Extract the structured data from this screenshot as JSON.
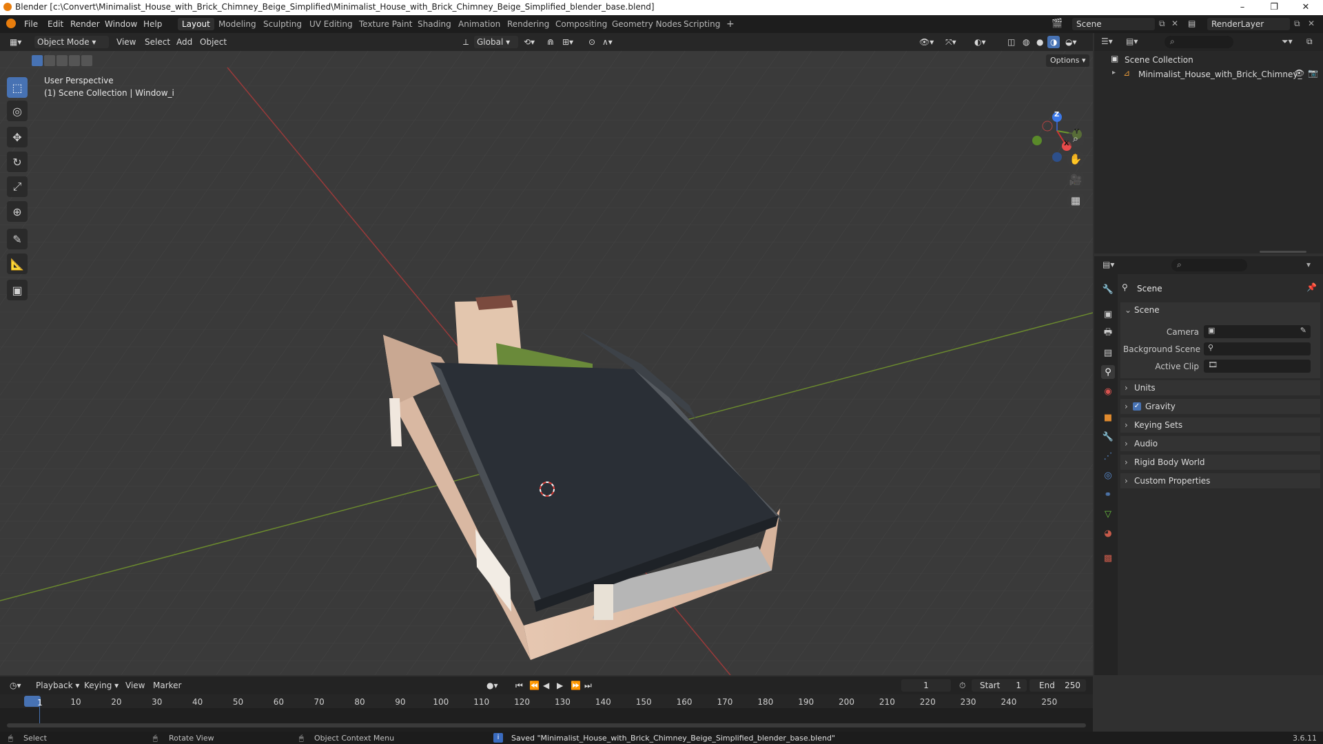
{
  "window": {
    "title": "Blender [c:\\Convert\\Minimalist_House_with_Brick_Chimney_Beige_Simplified\\Minimalist_House_with_Brick_Chimney_Beige_Simplified_blender_base.blend]",
    "minimize": "–",
    "maximize": "❐",
    "close": "✕"
  },
  "menus": [
    "File",
    "Edit",
    "Render",
    "Window",
    "Help"
  ],
  "workspaces": [
    {
      "label": "Layout",
      "active": true
    },
    {
      "label": "Modeling",
      "active": false
    },
    {
      "label": "Sculpting",
      "active": false
    },
    {
      "label": "UV Editing",
      "active": false
    },
    {
      "label": "Texture Paint",
      "active": false
    },
    {
      "label": "Shading",
      "active": false
    },
    {
      "label": "Animation",
      "active": false
    },
    {
      "label": "Rendering",
      "active": false
    },
    {
      "label": "Compositing",
      "active": false
    },
    {
      "label": "Geometry Nodes",
      "active": false
    },
    {
      "label": "Scripting",
      "active": false
    },
    {
      "label": "+",
      "active": false
    }
  ],
  "scene_selector": "Scene",
  "view_layer": "RenderLayer",
  "viewport_header": {
    "mode": "Object Mode",
    "menus": [
      "View",
      "Select",
      "Add",
      "Object"
    ],
    "orientation": "Global",
    "options": "Options"
  },
  "viewport": {
    "perspective": "User Perspective",
    "collection": "(1) Scene Collection | Window_i",
    "gizmo_axes": [
      "Z",
      "Y",
      "X"
    ]
  },
  "tools": [
    {
      "name": "select-box-tool",
      "glyph": "⬚",
      "active": true
    },
    {
      "name": "cursor-tool",
      "glyph": "◎",
      "active": false
    },
    {
      "name": "move-tool",
      "glyph": "✥",
      "active": false
    },
    {
      "name": "rotate-tool",
      "glyph": "↻",
      "active": false
    },
    {
      "name": "scale-tool",
      "glyph": "⤢",
      "active": false
    },
    {
      "name": "transform-tool",
      "glyph": "⊕",
      "active": false
    },
    {
      "name": "annotate-tool",
      "glyph": "✎",
      "active": false
    },
    {
      "name": "measure-tool",
      "glyph": "📐",
      "active": false
    },
    {
      "name": "add-cube-tool",
      "glyph": "▣",
      "active": false
    }
  ],
  "nav_gizmo_icons": [
    "zoom-icon",
    "pan-hand-icon",
    "camera-view-icon",
    "ortho-grid-icon"
  ],
  "outliner": {
    "root": "Scene Collection",
    "items": [
      {
        "label": "Minimalist_House_with_Brick_Chimney_"
      }
    ]
  },
  "properties": {
    "context": "Scene",
    "panel_title": "Scene",
    "fields": [
      {
        "label": "Camera"
      },
      {
        "label": "Background Scene"
      },
      {
        "label": "Active Clip"
      }
    ],
    "collapsed_panels": [
      {
        "label": "Units",
        "checkbox": false
      },
      {
        "label": "Gravity",
        "checkbox": true
      },
      {
        "label": "Keying Sets",
        "checkbox": false
      },
      {
        "label": "Audio",
        "checkbox": false
      },
      {
        "label": "Rigid Body World",
        "checkbox": false
      },
      {
        "label": "Custom Properties",
        "checkbox": false
      }
    ],
    "tab_colors": [
      "#cccccc",
      "#cccccc",
      "#cccccc",
      "#cccccc",
      "#cccccc",
      "#d9534f",
      "#e08a2e",
      "#5a8fd6",
      "#5a8fd6",
      "#5a8fd6",
      "#5a8fd6",
      "#6bc13f",
      "#c75a4a",
      "#c75a4a"
    ]
  },
  "timeline": {
    "menus": [
      "Playback",
      "Keying",
      "View",
      "Marker"
    ],
    "current_frame": "1",
    "start_label": "Start",
    "start": "1",
    "end_label": "End",
    "end": "250",
    "ticks": [
      "1",
      "10",
      "20",
      "30",
      "40",
      "50",
      "60",
      "70",
      "80",
      "90",
      "100",
      "110",
      "120",
      "130",
      "140",
      "150",
      "160",
      "170",
      "180",
      "190",
      "200",
      "210",
      "220",
      "230",
      "240",
      "250"
    ]
  },
  "statusbar": {
    "select": "Select",
    "rotate": "Rotate View",
    "context_menu": "Object Context Menu",
    "message": "Saved \"Minimalist_House_with_Brick_Chimney_Beige_Simplified_blender_base.blend\"",
    "version": "3.6.11"
  }
}
